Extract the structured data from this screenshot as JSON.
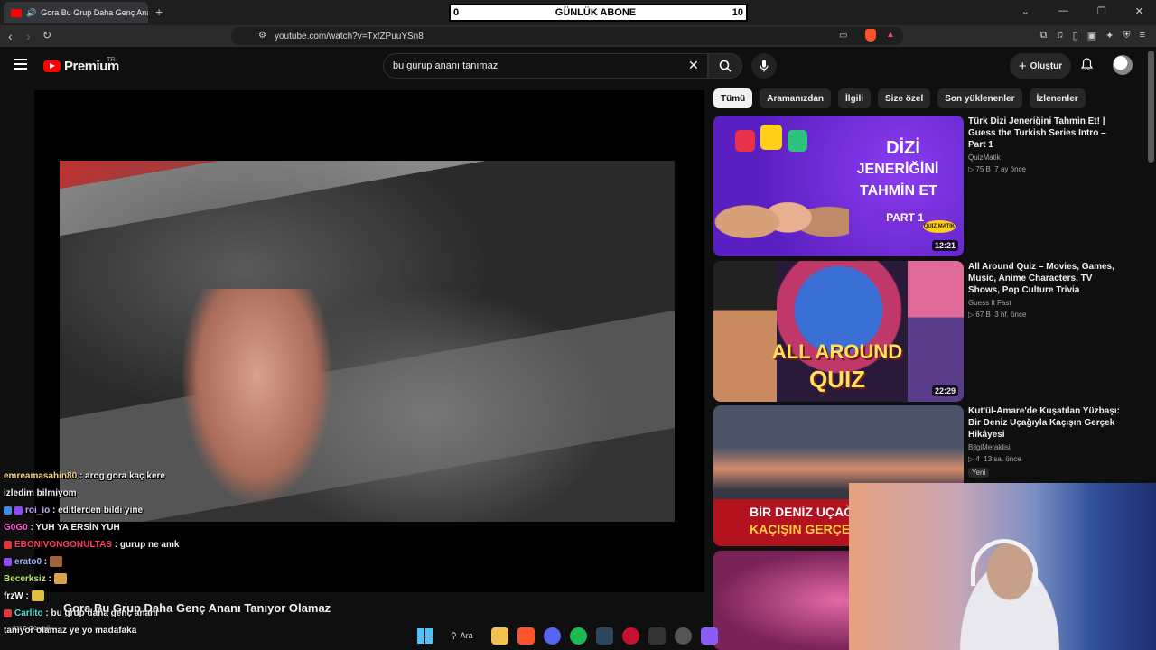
{
  "browser": {
    "tab_title": "Gora Bu Grup Daha Genç Ananı Tanıyor Olamaz",
    "new_tab": "+",
    "url": "youtube.com/watch?v=TxfZPuuYSn8",
    "window_controls": [
      "⌄",
      "—",
      "❐",
      "✕"
    ]
  },
  "overlay_counter": {
    "left": "0",
    "label": "GÜNLÜK ABONE",
    "right": "10"
  },
  "youtube": {
    "logo": "Premium",
    "logo_region": "TR",
    "search_value": "bu gurup ananı tanımaz",
    "create_label": "Oluştur",
    "video_title": "Gora Bu Grup Daha Genç Ananı Tanıyor Olamaz",
    "chips": [
      "Tümü",
      "Aramanızdan",
      "İlgili",
      "Size özel",
      "Son yüklenenler",
      "İzlenenler"
    ],
    "recommendations": [
      {
        "title": "Türk Dizi Jeneriğini Tahmin Et! | Guess the Turkish Series Intro – Part 1",
        "channel": "QuizMatik",
        "views": "▷ 75 B",
        "age": "7 ay önce",
        "duration": "12:21",
        "thumb_text_1": "DİZİ",
        "thumb_text_2": "JENERİĞİNİ",
        "thumb_text_3": "TAHMİN ET",
        "thumb_text_4": "PART 1",
        "thumb_badge": "QUIZ MATIK"
      },
      {
        "title": "All Around Quiz – Movies, Games, Music, Anime Characters, TV Shows, Pop Culture Trivia",
        "channel": "Guess It Fast",
        "views": "▷ 67 B",
        "age": "3 hf. önce",
        "duration": "22:29",
        "thumb_text_1": "ALL AROUND",
        "thumb_text_2": "QUIZ"
      },
      {
        "title": "Kut'ül-Amare'de Kuşatılan Yüzbaşı: Bir Deniz Uçağıyla Kaçışın Gerçek Hikâyesi",
        "channel": "BilgiMeraklisi",
        "views": "▷ 4",
        "age": "13 sa. önce",
        "badge": "Yeni",
        "thumb_text_1": "BİR DENİZ UÇAĞ",
        "thumb_text_2": "KAÇIŞIN GERÇE"
      }
    ]
  },
  "chat": [
    {
      "user": "emreamasahin80",
      "color": "#f4d58d",
      "msg": ": arog gora kaç kere"
    },
    {
      "user": "",
      "color": "#ffffff",
      "msg": "izledim bilmiyom"
    },
    {
      "user": "roi_io",
      "color": "#c7a4ff",
      "msg": ": editlerden bildi yine"
    },
    {
      "user": "G0G0",
      "color": "#ff5cd6",
      "msg": ": YUH YA ERSİN YUH"
    },
    {
      "user": "EBONIVONGONULTAS",
      "color": "#ff3d5a",
      "msg": ": gurup ne amk"
    },
    {
      "user": "erato0",
      "color": "#9fb3ff",
      "msg": ":"
    },
    {
      "user": "Becerksiz",
      "color": "#b8e36f",
      "msg": ":"
    },
    {
      "user": "frzW",
      "color": "#ffffff",
      "msg": ":"
    },
    {
      "user": "Carlito",
      "color": "#5ce0d6",
      "msg": ": bu grup daha genç ananı"
    },
    {
      "user": "",
      "color": "#ffffff",
      "msg": "tanıyor olamaz ye yo madafaka"
    }
  ],
  "taskbar": {
    "search_label": "Ara",
    "weather_temp": "21°C",
    "weather_desc": "Güneşli"
  }
}
